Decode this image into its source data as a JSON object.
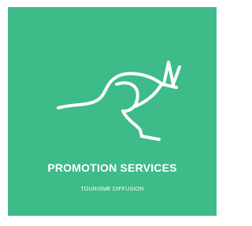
{
  "logo": {
    "icon": "kangaroo-icon",
    "background_color": "#3dbb88",
    "foreground_color": "#ffffff"
  },
  "brand": {
    "name": "PROMOTION SERVICES",
    "tagline": "TOURISME DIFFUSION"
  }
}
